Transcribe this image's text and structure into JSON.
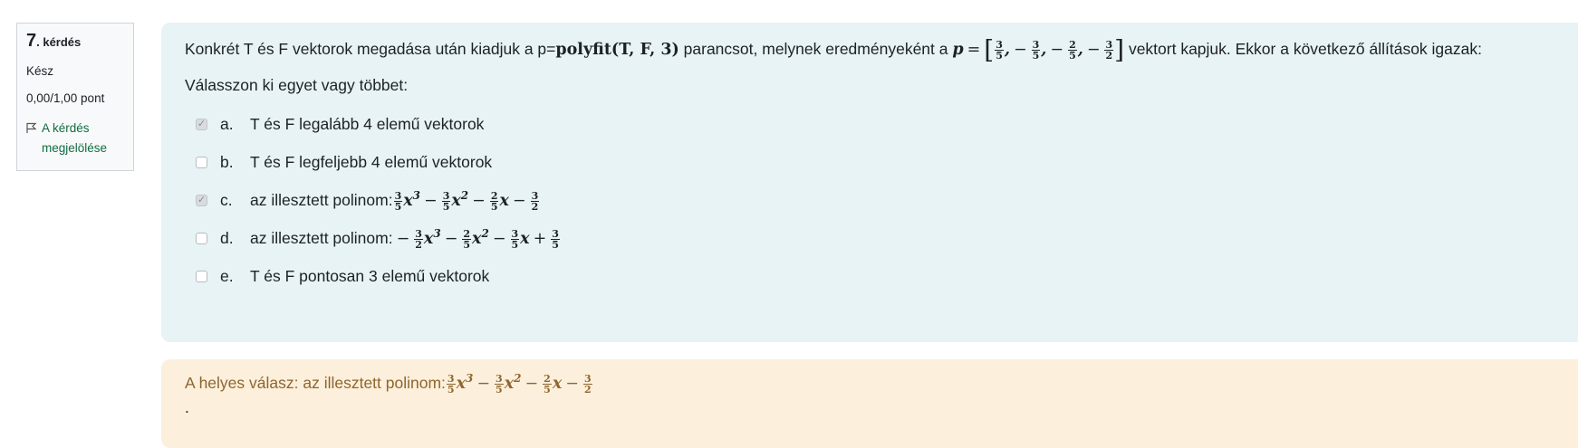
{
  "info": {
    "number": "7",
    "label": ". kérdés",
    "state": "Kész",
    "grade": "0,00/1,00 pont",
    "flag_label": "A kérdés megjelölése"
  },
  "question": {
    "text_pre": "Konkrét T és F vektorok megadása után kiadjuk a p=",
    "command": "polyfit(T, F, 3)",
    "text_mid": " parancsot, melynek eredményeként a ",
    "result_vector": "p = [3/5, −3/5, −2/5, −3/2]",
    "text_post": " vektort kapjuk. Ekkor a következő állítások igazak:",
    "prompt": "Válasszon ki egyet vagy többet:"
  },
  "answers": [
    {
      "letter": "a.",
      "text": "T és F legalább 4 elemű vektorok",
      "checked": true
    },
    {
      "letter": "b.",
      "text": "T és F legfeljebb 4 elemű vektorok",
      "checked": false
    },
    {
      "letter": "c.",
      "text": "az illesztett polinom:",
      "formula": "3/5 x³ − 3/5 x² − 2/5 x − 3/2",
      "checked": true
    },
    {
      "letter": "d.",
      "text": "az illesztett polinom:",
      "formula": "−3/2 x³ − 2/5 x² − 3/5 x + 3/5",
      "checked": false
    },
    {
      "letter": "e.",
      "text": "T és F pontosan 3 elemű vektorok",
      "checked": false
    }
  ],
  "feedback": {
    "text": "A helyes válasz: az illesztett polinom:",
    "formula": "3/5 x³ − 3/5 x² − 2/5 x − 3/2",
    "trailing": "."
  }
}
